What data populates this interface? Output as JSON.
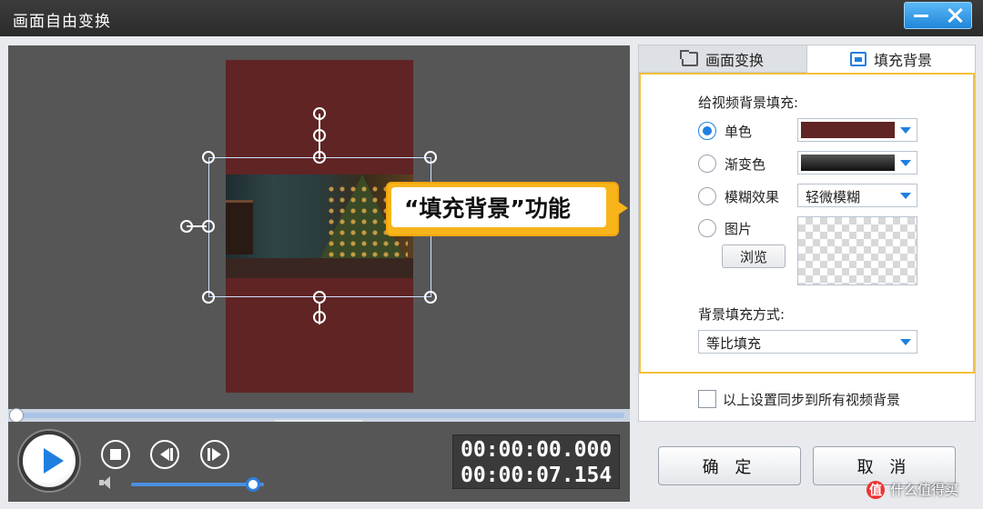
{
  "window": {
    "title": "画面自由变换",
    "minimize_icon": "minimize-icon",
    "close_icon": "close-icon",
    "accent": "#1f86d8"
  },
  "preview": {
    "background_color": "#602424",
    "callout": "“填充背景”功能"
  },
  "player": {
    "timecode_current": "00:00:00.000",
    "timecode_total": "00:00:07.154",
    "volume": 0.92,
    "progress": 0.0
  },
  "tabs": [
    {
      "label": "画面变换",
      "icon": "transform-icon",
      "active": false
    },
    {
      "label": "填充背景",
      "icon": "fill-background-icon",
      "active": true
    }
  ],
  "fill": {
    "section_label": "给视频背景填充:",
    "options": [
      {
        "label": "单色",
        "checked": true
      },
      {
        "label": "渐变色",
        "checked": false
      },
      {
        "label": "模糊效果",
        "checked": false
      },
      {
        "label": "图片",
        "checked": false
      }
    ],
    "solid_color": "#602424",
    "blur_value": "轻微模糊",
    "browse_label": "浏览",
    "mode_label": "背景填充方式:",
    "mode_value": "等比填充",
    "highlight_color": "#f5c13c"
  },
  "sync": {
    "label": "以上设置同步到所有视频背景",
    "checked": false
  },
  "buttons": {
    "ok": "确 定",
    "cancel": "取 消"
  },
  "watermark": {
    "badge": "值",
    "text": "什么值得买"
  }
}
